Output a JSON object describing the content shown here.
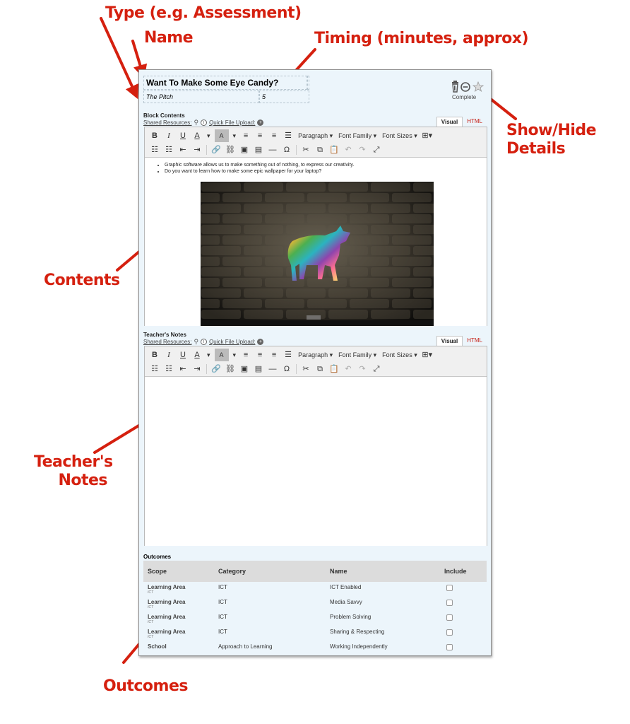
{
  "annotations": {
    "type": "Type (e.g. Assessment)",
    "name": "Name",
    "timing": "Timing (minutes, approx)",
    "show_hide_1": "Show/Hide",
    "show_hide_2": "Details",
    "contents": "Contents",
    "teachers_notes_1": "Teacher's",
    "teachers_notes_2": "Notes",
    "outcomes": "Outcomes"
  },
  "block": {
    "title": "Want To Make Some Eye Candy?",
    "type_value": "The Pitch",
    "timing_value": "5",
    "complete_label": "Complete"
  },
  "block_contents": {
    "label": "Block Contents",
    "shared_resources": "Shared Resources:",
    "quick_upload": "Quick File Upload:",
    "tab_visual": "Visual",
    "tab_html": "HTML",
    "bullets": [
      "Graphic software allows us to make something out of nothing, to express our creativity.",
      "Do you want to learn how to make some epic wallpaper for your laptop?"
    ]
  },
  "teachers_notes": {
    "label": "Teacher's Notes",
    "shared_resources": "Shared Resources:",
    "quick_upload": "Quick File Upload:",
    "tab_visual": "Visual",
    "tab_html": "HTML"
  },
  "toolbar": {
    "bold": "B",
    "italic": "I",
    "underline": "U",
    "font_color": "A",
    "bg_color": "A",
    "paragraph": "Paragraph",
    "font_family": "Font Family",
    "font_sizes": "Font Sizes",
    "special_char": "Ω"
  },
  "outcomes": {
    "title": "Outcomes",
    "headers": [
      "Scope",
      "Category",
      "Name",
      "Include"
    ],
    "rows": [
      {
        "scope": "Learning Area",
        "sub": "ICT",
        "category": "ICT",
        "name": "ICT Enabled"
      },
      {
        "scope": "Learning Area",
        "sub": "ICT",
        "category": "ICT",
        "name": "Media Savvy"
      },
      {
        "scope": "Learning Area",
        "sub": "ICT",
        "category": "ICT",
        "name": "Problem Solving"
      },
      {
        "scope": "Learning Area",
        "sub": "ICT",
        "category": "ICT",
        "name": "Sharing & Respecting"
      },
      {
        "scope": "School",
        "sub": "",
        "category": "Approach to Learning",
        "name": "Working Independently"
      }
    ]
  },
  "colors": {
    "annotation": "#d5200f",
    "panel_bg": "#ecf5fb",
    "html_tab": "#c7231a"
  }
}
